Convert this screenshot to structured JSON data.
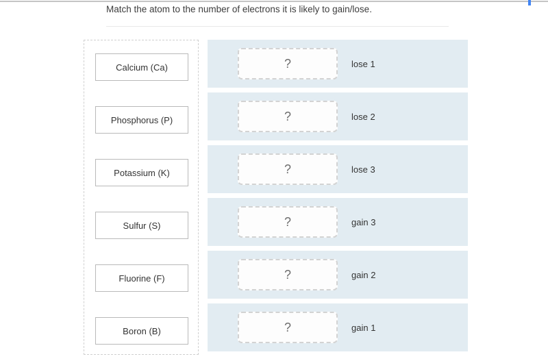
{
  "question": {
    "text": "Match the atom to the number of electrons it is likely to gain/lose."
  },
  "scrollbar": {
    "accent_color": "#4285f4",
    "rail_color": "#c4c4c4"
  },
  "colors": {
    "dropzone_background": "#e2ecf2",
    "card_border": "#b9b9b9",
    "bank_border": "#cfcfcf",
    "slot_border": "#d3d3d3",
    "divider": "#e8e8e8"
  },
  "bank": {
    "name": "atom-options",
    "items": [
      {
        "label": "Calcium (Ca)"
      },
      {
        "label": "Phosphorus (P)"
      },
      {
        "label": "Potassium (K)"
      },
      {
        "label": "Sulfur (S)"
      },
      {
        "label": "Fluorine (F)"
      },
      {
        "label": "Boron (B)"
      }
    ]
  },
  "dropzones": {
    "placeholder": "?",
    "rows": [
      {
        "placeholder": "?",
        "label": "lose 1"
      },
      {
        "placeholder": "?",
        "label": "lose 2"
      },
      {
        "placeholder": "?",
        "label": "lose 3"
      },
      {
        "placeholder": "?",
        "label": "gain 3"
      },
      {
        "placeholder": "?",
        "label": "gain 2"
      },
      {
        "placeholder": "?",
        "label": "gain 1"
      }
    ]
  }
}
